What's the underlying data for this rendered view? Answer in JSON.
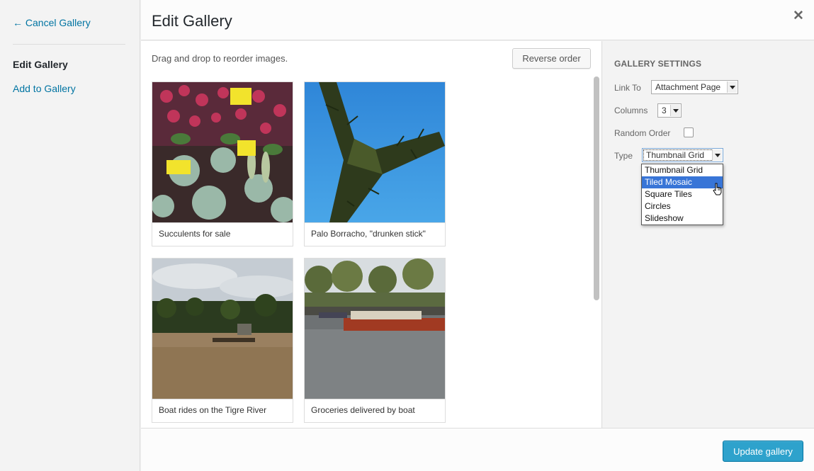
{
  "sidebar": {
    "cancel_label": "← Cancel Gallery",
    "items": [
      {
        "label": "Edit Gallery"
      },
      {
        "label": "Add to Gallery"
      }
    ]
  },
  "header": {
    "title": "Edit Gallery",
    "close_glyph": "✕"
  },
  "content": {
    "instructions": "Drag and drop to reorder images.",
    "reverse_label": "Reverse order",
    "images": [
      {
        "caption": "Succulents for sale",
        "thumb_icon": "succulents-photo"
      },
      {
        "caption": "Palo Borracho, \"drunken stick\"",
        "thumb_icon": "cactus-branch-photo"
      },
      {
        "caption": "Boat rides on the Tigre River",
        "thumb_icon": "river-dock-photo"
      },
      {
        "caption": "Groceries delivered by boat",
        "thumb_icon": "river-boat-photo"
      }
    ]
  },
  "settings": {
    "heading": "GALLERY SETTINGS",
    "link_to": {
      "label": "Link To",
      "value": "Attachment Page"
    },
    "columns": {
      "label": "Columns",
      "value": "3"
    },
    "random_order": {
      "label": "Random Order",
      "checked": false
    },
    "type": {
      "label": "Type",
      "value": "Thumbnail Grid",
      "options": [
        "Thumbnail Grid",
        "Tiled Mosaic",
        "Square Tiles",
        "Circles",
        "Slideshow"
      ],
      "highlighted": "Tiled Mosaic"
    }
  },
  "footer": {
    "update_label": "Update gallery"
  },
  "colors": {
    "accent": "#2ea2cc",
    "link": "#0074a2",
    "highlight": "#3875d7"
  }
}
